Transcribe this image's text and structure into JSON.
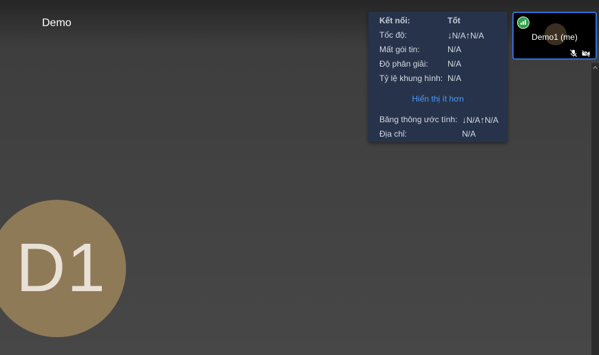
{
  "room": {
    "title": "Demo"
  },
  "large_avatar": {
    "initials": "D1",
    "color": "#8f7a58"
  },
  "connection_stats": {
    "connection": {
      "label": "Kết nối:",
      "value": "Tốt"
    },
    "bitrate": {
      "label": "Tốc độ:",
      "down_arrow": "↓",
      "down": "N/A",
      "up_arrow": "↑",
      "up": "N/A"
    },
    "packet_loss": {
      "label": "Mất gói tin:",
      "value": "N/A"
    },
    "resolution": {
      "label": "Độ phân giải:",
      "value": "N/A"
    },
    "framerate": {
      "label": "Tỷ lệ khung hình:",
      "value": "N/A"
    },
    "show_less": "Hiển thị ít hơn",
    "bandwidth": {
      "label": "Băng thông ước tính:",
      "down_arrow": "↓",
      "down": "N/A",
      "up_arrow": "↑",
      "up": "N/A"
    },
    "address": {
      "label": "Địa chỉ:",
      "value": "N/A"
    }
  },
  "thumbnail": {
    "name": "Demo1 (me)",
    "icons": [
      "connection-indicator-icon",
      "mic-muted-icon",
      "camera-off-icon"
    ],
    "border_color": "#2f6fd6",
    "indicator_color": "#31a24c"
  }
}
